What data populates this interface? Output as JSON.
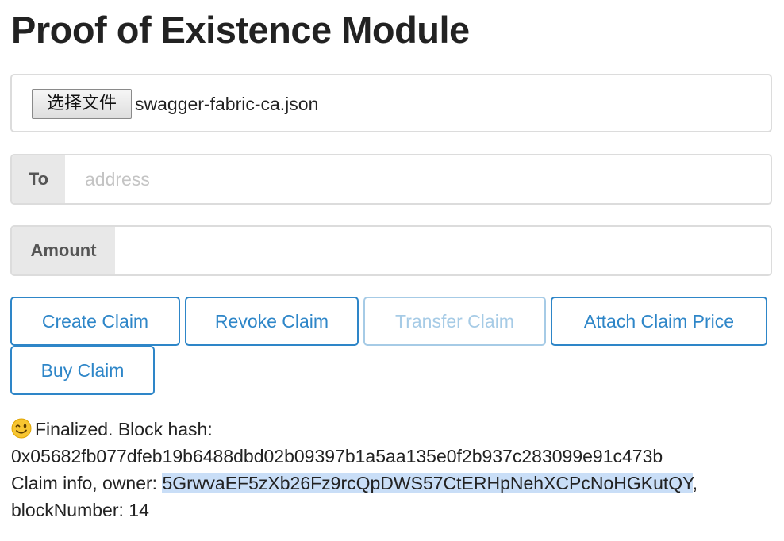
{
  "header": {
    "title": "Proof of Existence Module"
  },
  "file_input": {
    "button_label": "选择文件",
    "file_name": "swagger-fabric-ca.json"
  },
  "to_field": {
    "label": "To",
    "placeholder": "address",
    "value": ""
  },
  "amount_field": {
    "label": "Amount",
    "placeholder": "",
    "value": ""
  },
  "actions": {
    "create": "Create Claim",
    "revoke": "Revoke Claim",
    "transfer": "Transfer Claim",
    "attach_price": "Attach Claim Price",
    "buy": "Buy Claim"
  },
  "status": {
    "emoji_icon": "winking-face-icon",
    "finalized_text": "Finalized. Block hash:",
    "block_hash": "0x05682fb077dfeb19b6488dbd02b09397b1a5aa135e0f2b937c283099e91c473b",
    "claim_info_prefix": "Claim info, owner:",
    "owner_address": "5GrwvaEF5zXb26Fz9rcQpDWS57CtERHpNehXCPcNoHGKutQY",
    "separator": ",",
    "block_number_text": "blockNumber: 14"
  },
  "colors": {
    "accent": "#2e86c8",
    "accent_disabled": "#a6cbe6",
    "label_bg": "#e8e8e8",
    "selection_highlight": "#c9def7"
  }
}
